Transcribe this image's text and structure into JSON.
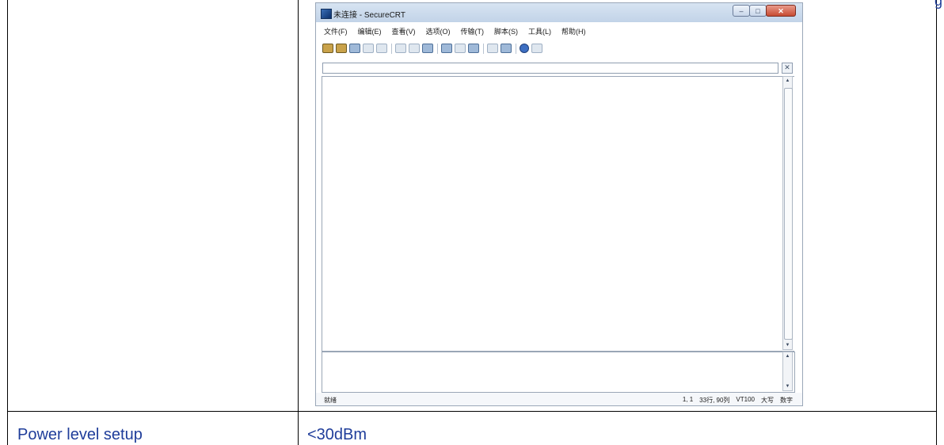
{
  "page": {
    "top_right_fragment": "g",
    "row_label": "Power level setup",
    "row_value": "<30dBm"
  },
  "window": {
    "title": "未连接 - SecureCRT",
    "buttons": {
      "minimize": "‒",
      "maximize": "□",
      "close": "✕"
    },
    "menu": [
      "文件(F)",
      "编辑(E)",
      "查看(V)",
      "选项(O)",
      "传输(T)",
      "脚本(S)",
      "工具(L)",
      "帮助(H)"
    ],
    "address_close": "✕",
    "status": {
      "ready": "就绪",
      "position": "1, 1",
      "size": "33行, 90列",
      "terminal": "VT100",
      "caps": "大写",
      "num": "数字"
    }
  },
  "colors": {
    "link_blue": "#1f3d9a",
    "title_gradient_top": "#d7e4f2",
    "close_red": "#c74b32"
  },
  "icons": {
    "toolbar": [
      "connect-icon",
      "quick-connect-icon",
      "connect-tab-icon",
      "reconnect-icon",
      "disconnect-icon",
      "copy-icon",
      "paste-icon",
      "find-icon",
      "print-icon",
      "print-setup-icon",
      "session-options-icon",
      "map-keys-icon",
      "help-icon",
      "keymap-icon"
    ]
  }
}
